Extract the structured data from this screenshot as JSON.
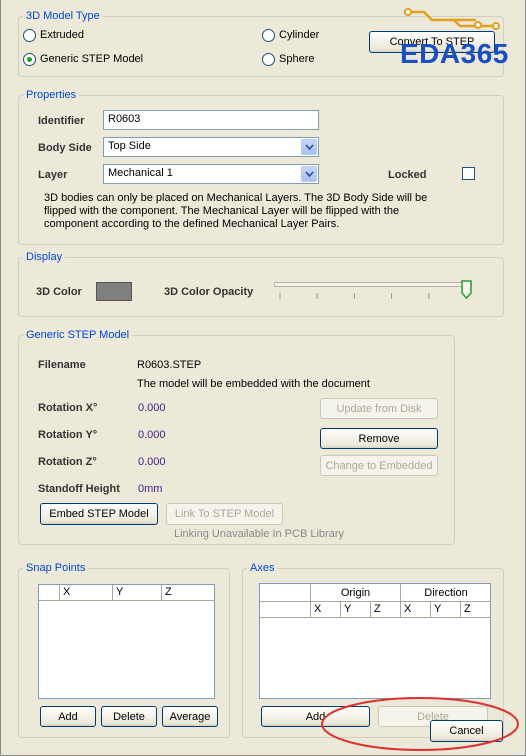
{
  "model_type": {
    "legend": "3D Model Type",
    "options": [
      "Extruded",
      "Generic STEP Model",
      "Cylinder",
      "Sphere"
    ],
    "selected": "Generic STEP Model",
    "convert_button": "Convert To STEP"
  },
  "logo": {
    "text": "EDA365",
    "color": "#1a4fc4"
  },
  "properties": {
    "legend": "Properties",
    "identifier_label": "Identifier",
    "identifier_value": "R0603",
    "body_side_label": "Body Side",
    "body_side_value": "Top Side",
    "layer_label": "Layer",
    "layer_value": "Mechanical 1",
    "locked_label": "Locked",
    "note": "3D bodies can only be placed on Mechanical Layers. The 3D Body Side will be flipped with the component. The Mechanical Layer will be flipped with the component according to the defined Mechanical Layer Pairs."
  },
  "display": {
    "legend": "Display",
    "color_label": "3D Color",
    "color_value": "#7f7f7f",
    "opacity_label": "3D Color Opacity",
    "opacity_level": 1.0
  },
  "step_model": {
    "legend": "Generic STEP Model",
    "filename_label": "Filename",
    "filename_value": "R0603.STEP",
    "embedded_note": "The model will be embedded with the document",
    "rotation_x_label": "Rotation X°",
    "rotation_x_value": "0.000",
    "rotation_y_label": "Rotation Y°",
    "rotation_y_value": "0.000",
    "rotation_z_label": "Rotation Z°",
    "rotation_z_value": "0.000",
    "standoff_label": "Standoff Height",
    "standoff_value": "0mm",
    "update_button": "Update from Disk",
    "remove_button": "Remove",
    "change_button": "Change to Embedded",
    "embed_button": "Embed STEP Model",
    "link_button": "Link To STEP Model",
    "link_note": "Linking Unavailable In PCB Library"
  },
  "snap_points": {
    "legend": "Snap Points",
    "columns": [
      "",
      "X",
      "Y",
      "Z"
    ],
    "add_button": "Add",
    "delete_button": "Delete",
    "average_button": "Average"
  },
  "axes": {
    "legend": "Axes",
    "group_headers": [
      "Origin",
      "Direction"
    ],
    "columns": [
      "X",
      "Y",
      "Z",
      "X",
      "Y",
      "Z"
    ],
    "add_button": "Add",
    "delete_button": "Delete"
  },
  "cancel_button": "Cancel",
  "annotation_color": "#e03030"
}
